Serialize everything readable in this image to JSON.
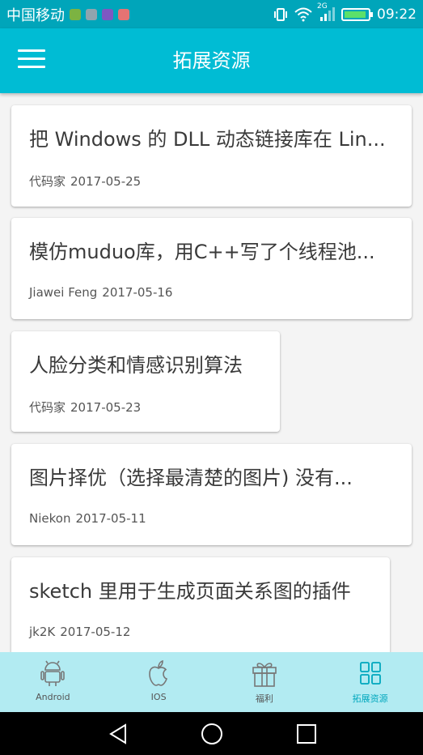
{
  "status_bar": {
    "carrier": "中国移动",
    "network": "2G",
    "time": "09:22",
    "icons": [
      "notification-green-icon",
      "notification-gallery-icon",
      "notification-purple-icon",
      "notification-red-icon",
      "vibrate-icon",
      "wifi-icon",
      "signal-icon",
      "battery-charging-icon"
    ]
  },
  "app_bar": {
    "title": "拓展资源",
    "menu_icon": "hamburger-menu-icon"
  },
  "articles": [
    {
      "title": "把 Windows 的 DLL 动态链接库在 Lin...",
      "author": "代码家",
      "date": "2017-05-25"
    },
    {
      "title": "模仿muduo库，用C++写了个线程池...",
      "author": "Jiawei Feng",
      "date": "2017-05-16"
    },
    {
      "title": "人脸分类和情感识别算法",
      "author": "代码家",
      "date": "2017-05-23"
    },
    {
      "title": "图片择优（选择最清楚的图片) 没有...",
      "author": "Niekon",
      "date": "2017-05-11"
    },
    {
      "title": "sketch 里用于生成页面关系图的插件",
      "author": "jk2K",
      "date": "2017-05-12"
    }
  ],
  "bottom_nav": {
    "tabs": [
      {
        "label": "Android",
        "icon": "android-icon",
        "active": false
      },
      {
        "label": "IOS",
        "icon": "apple-icon",
        "active": false
      },
      {
        "label": "福利",
        "icon": "gift-icon",
        "active": false
      },
      {
        "label": "拓展资源",
        "icon": "grid-icon",
        "active": true
      }
    ]
  },
  "colors": {
    "status_bar": "#00a5ba",
    "app_bar": "#00bcd4",
    "bottom_nav": "#b2ebf2",
    "active_tab": "#00a7bd"
  }
}
